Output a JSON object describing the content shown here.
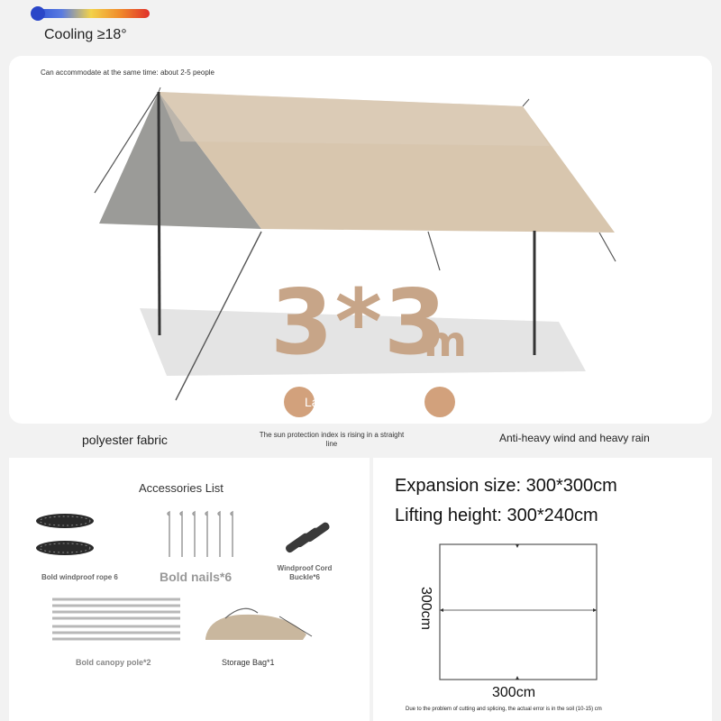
{
  "temperature": {
    "label": "Cooling ≥18°"
  },
  "hero": {
    "capacity": "Can accommodate at the same time: about 2-5 people",
    "size_number": "3*3",
    "size_unit": "m",
    "badge_text": "La                    e"
  },
  "features": {
    "left": "polyester fabric",
    "middle": "The sun protection index is rising in a straight line",
    "right": "Anti-heavy wind and heavy rain"
  },
  "accessories": {
    "title": "Accessories List",
    "items": [
      {
        "label": "Bold windproof rope 6",
        "icon": "rope-icon"
      },
      {
        "label": "Bold nails*6",
        "icon": "nail-icon"
      },
      {
        "label": "Windproof Cord Buckle*6",
        "icon": "buckle-icon"
      },
      {
        "label": "Bold canopy pole*2",
        "icon": "pole-icon"
      },
      {
        "label": "Storage Bag*1",
        "icon": "bag-icon"
      }
    ]
  },
  "specs": {
    "expansion": "Expansion size: 300*300cm",
    "lifting": "Lifting height: 300*240cm",
    "dim_vertical": "300cm",
    "dim_horizontal": "300cm",
    "note": "Due to the problem of cutting and splicing, the actual error is in the soil (10-15) cm"
  },
  "colors": {
    "tent_fabric": "#d8c6ae",
    "size_text": "#c7a588",
    "badge": "#d2a17c"
  }
}
